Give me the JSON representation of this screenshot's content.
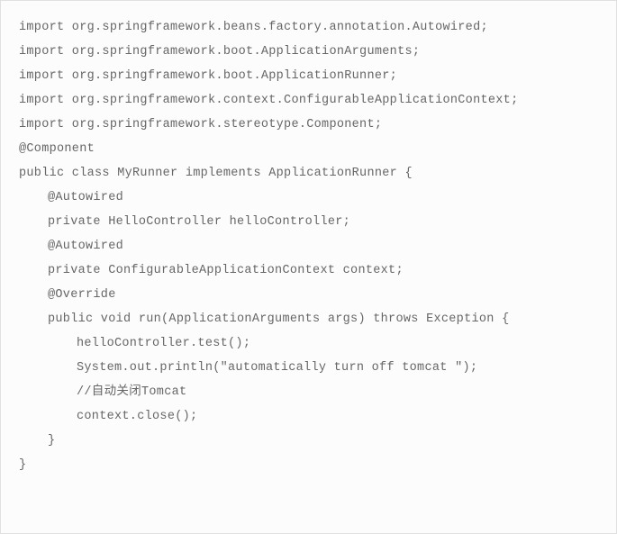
{
  "code": {
    "lines": [
      {
        "text": "import org.springframework.beans.factory.annotation.Autowired;",
        "indent": 0
      },
      {
        "text": "import org.springframework.boot.ApplicationArguments;",
        "indent": 0
      },
      {
        "text": "import org.springframework.boot.ApplicationRunner;",
        "indent": 0
      },
      {
        "text": "import org.springframework.context.ConfigurableApplicationContext;",
        "indent": 0
      },
      {
        "text": "import org.springframework.stereotype.Component;",
        "indent": 0
      },
      {
        "text": "",
        "indent": 0
      },
      {
        "text": "@Component",
        "indent": 0
      },
      {
        "text": "public class MyRunner implements ApplicationRunner {",
        "indent": 0
      },
      {
        "text": "",
        "indent": 0
      },
      {
        "text": "@Autowired",
        "indent": 1
      },
      {
        "text": "private HelloController helloController;",
        "indent": 1
      },
      {
        "text": "@Autowired",
        "indent": 1
      },
      {
        "text": "private ConfigurableApplicationContext context;",
        "indent": 1
      },
      {
        "text": "",
        "indent": 0
      },
      {
        "text": "@Override",
        "indent": 1
      },
      {
        "text": "public void run(ApplicationArguments args) throws Exception {",
        "indent": 1
      },
      {
        "text": "helloController.test();",
        "indent": 2
      },
      {
        "text": "System.out.println(\"automatically turn off tomcat \");",
        "indent": 2
      },
      {
        "text": "//自动关闭Tomcat",
        "indent": 2
      },
      {
        "text": "context.close();",
        "indent": 2
      },
      {
        "text": "}",
        "indent": 1
      },
      {
        "text": "}",
        "indent": 0
      }
    ]
  }
}
